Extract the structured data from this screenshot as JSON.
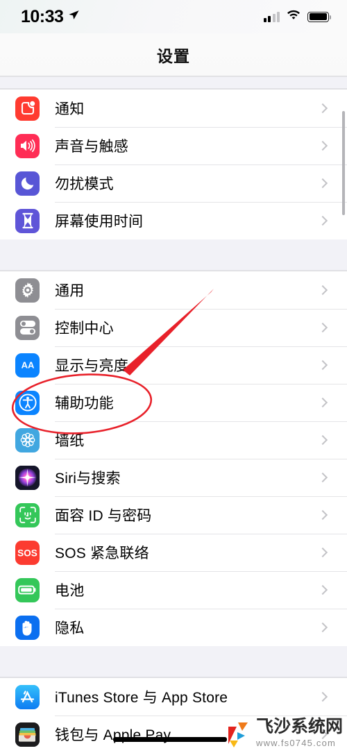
{
  "status_bar": {
    "time": "10:33",
    "location_icon": "location-arrow-icon",
    "signal_icon": "cellular-signal-icon",
    "wifi_icon": "wifi-icon",
    "battery_icon": "battery-full-icon",
    "signal_bars_active": 2,
    "signal_bars_total": 4
  },
  "nav": {
    "title": "设置"
  },
  "colors": {
    "notifications": "#ff3b30",
    "sounds": "#ff2d55",
    "dnd": "#5856d6",
    "screentime": "#5f55d8",
    "general": "#8e8e93",
    "control_center": "#8e8e93",
    "display": "#0b84ff",
    "accessibility": "#0b84ff",
    "wallpaper": "#41a7e0",
    "siri": "#141423",
    "faceid": "#34c759",
    "sos": "#fc3b30",
    "battery": "#34c759",
    "privacy": "#0b6ff0",
    "appstore": "#1e9dfa",
    "wallet": "#1c1c1e",
    "annotation": "#e8212a",
    "chevron": "#c3c3c7"
  },
  "groups": [
    {
      "name": "group-1",
      "rows": [
        {
          "label": "通知",
          "icon": "notification-badge-icon",
          "color_key": "notifications"
        },
        {
          "label": "声音与触感",
          "icon": "speaker-waves-icon",
          "color_key": "sounds"
        },
        {
          "label": "勿扰模式",
          "icon": "moon-icon",
          "color_key": "dnd"
        },
        {
          "label": "屏幕使用时间",
          "icon": "hourglass-icon",
          "color_key": "screentime"
        }
      ]
    },
    {
      "name": "group-2",
      "rows": [
        {
          "label": "通用",
          "icon": "gear-icon",
          "color_key": "general"
        },
        {
          "label": "控制中心",
          "icon": "toggles-icon",
          "color_key": "control_center"
        },
        {
          "label": "显示与亮度",
          "icon": "aa-text-icon",
          "color_key": "display"
        },
        {
          "label": "辅助功能",
          "icon": "accessibility-icon",
          "color_key": "accessibility"
        },
        {
          "label": "墙纸",
          "icon": "flower-wallpaper-icon",
          "color_key": "wallpaper"
        },
        {
          "label": "Siri与搜索",
          "icon": "siri-orb-icon",
          "color_key": "siri"
        },
        {
          "label": "面容 ID 与密码",
          "icon": "face-id-icon",
          "color_key": "faceid"
        },
        {
          "label": "SOS 紧急联络",
          "icon": "sos-icon",
          "color_key": "sos"
        },
        {
          "label": "电池",
          "icon": "battery-icon",
          "color_key": "battery"
        },
        {
          "label": "隐私",
          "icon": "hand-raised-icon",
          "color_key": "privacy"
        }
      ]
    },
    {
      "name": "group-3",
      "rows": [
        {
          "label": "iTunes Store 与 App Store",
          "icon": "app-store-icon",
          "color_key": "appstore"
        },
        {
          "label": "钱包与 Apple Pay",
          "icon": "wallet-icon",
          "color_key": "wallet"
        }
      ]
    }
  ],
  "annotations": {
    "ellipse_target": "辅助功能",
    "arrow": "red-arrow-pointing-to-accessibility",
    "redaction_bar": "black-redaction-bar"
  },
  "watermark": {
    "name": "飞沙系统网",
    "url": "www.fs0745.com",
    "logo_icon": "fs-logo-icon"
  }
}
